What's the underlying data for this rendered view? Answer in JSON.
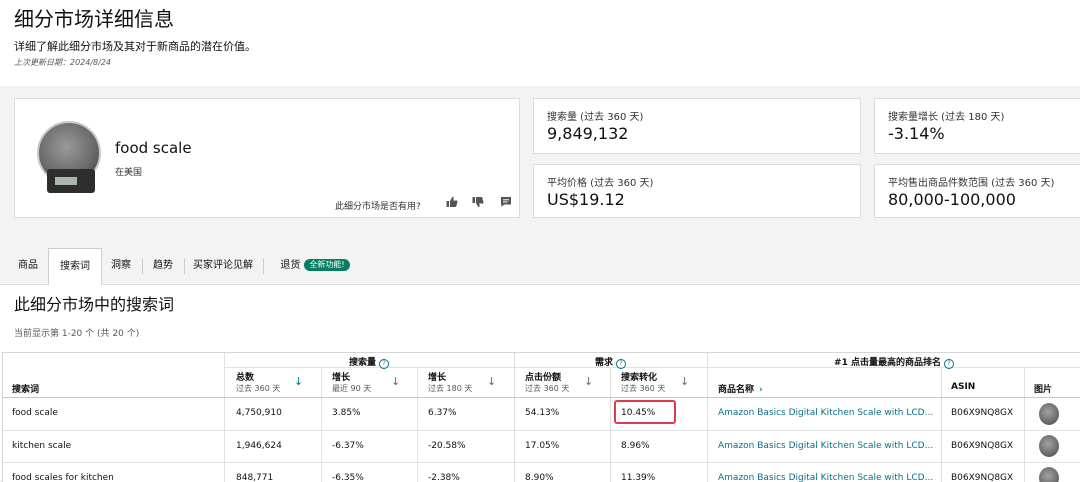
{
  "header": {
    "title": "细分市场详细信息",
    "subtitle": "详细了解此细分市场及其对于新商品的潜在价值。",
    "last_updated": "上次更新日期：2024/8/24"
  },
  "product": {
    "name": "food scale",
    "location": "在美国",
    "feedback_question": "此细分市场是否有用?",
    "icons": [
      "thumbs-up-icon",
      "thumbs-down-icon",
      "comment-icon"
    ]
  },
  "metrics": [
    {
      "label": "搜索量 (过去 360 天)",
      "value": "9,849,132"
    },
    {
      "label": "平均价格 (过去 360 天)",
      "value": "US$19.12"
    },
    {
      "label": "搜索量增长 (过去 180 天)",
      "value": "-3.14%"
    },
    {
      "label": "平均售出商品件数范围 (过去 360 天)",
      "value": "80,000-100,000"
    }
  ],
  "tabs": [
    {
      "label": "商品"
    },
    {
      "label": "搜索词",
      "active": true
    },
    {
      "label": "洞察"
    },
    {
      "label": "趋势"
    },
    {
      "label": "买家评论见解"
    },
    {
      "label": "退货",
      "badge": "全新功能!"
    }
  ],
  "section": {
    "title": "此细分市场中的搜索词",
    "count": "当前显示第 1-20 个 (共 20 个)"
  },
  "table": {
    "groups": {
      "search_volume": "搜索量",
      "demand": "需求",
      "top_product": "#1 点击量最高的商品排名"
    },
    "columns": {
      "term": "搜索词",
      "total": "总数",
      "total_sub": "过去 360 天",
      "growth90": "增长",
      "growth90_sub": "最近 90 天",
      "growth180": "增长",
      "growth180_sub": "过去 180 天",
      "click_share": "点击份额",
      "click_share_sub": "过去 360 天",
      "conversion": "搜索转化",
      "conversion_sub": "过去 360 天",
      "product_name": "商品名称",
      "asin": "ASIN",
      "image": "图片"
    },
    "rows": [
      {
        "term": "food scale",
        "total": "4,750,910",
        "growth90": "3.85%",
        "growth180": "6.37%",
        "click_share": "54.13%",
        "conversion": "10.45%",
        "product": "Amazon Basics Digital Kitchen Scale with LCD...",
        "asin": "B06X9NQ8GX"
      },
      {
        "term": "kitchen scale",
        "total": "1,946,624",
        "growth90": "-6.37%",
        "growth180": "-20.58%",
        "click_share": "17.05%",
        "conversion": "8.96%",
        "product": "Amazon Basics Digital Kitchen Scale with LCD...",
        "asin": "B06X9NQ8GX"
      },
      {
        "term": "food scales for kitchen",
        "total": "848,771",
        "growth90": "-6.35%",
        "growth180": "-2.38%",
        "click_share": "8.90%",
        "conversion": "11.39%",
        "product": "Amazon Basics Digital Kitchen Scale with LCD...",
        "asin": "B06X9NQ8GX"
      }
    ]
  }
}
